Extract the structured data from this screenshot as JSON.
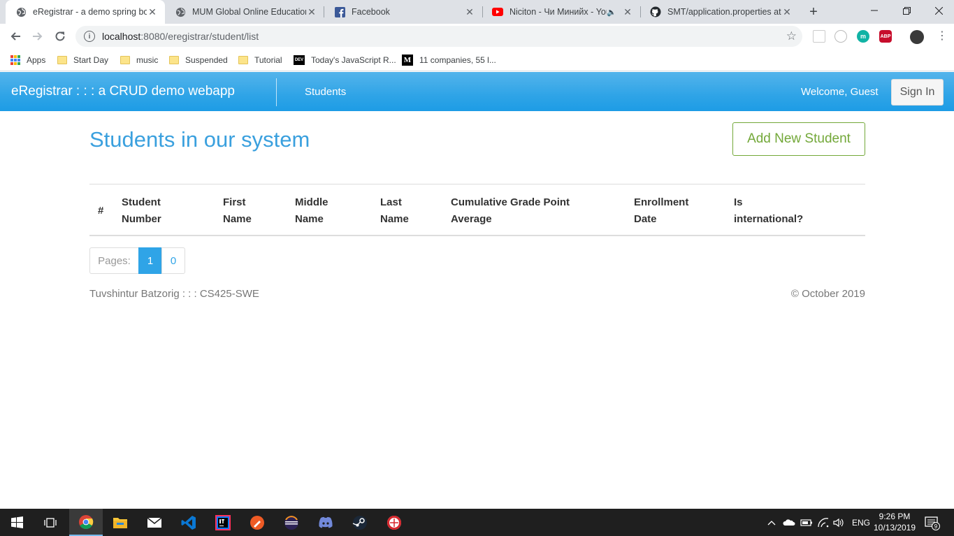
{
  "browser": {
    "tabs": [
      {
        "title": "eRegistrar - a demo spring boo",
        "favicon": "globe-icon",
        "active": true
      },
      {
        "title": "MUM Global Online Education",
        "favicon": "globe-icon",
        "active": false
      },
      {
        "title": "Facebook",
        "favicon": "facebook-icon",
        "active": false
      },
      {
        "title": "Niciton - Чи Минийх - You",
        "favicon": "youtube-icon",
        "active": false,
        "audio": true
      },
      {
        "title": "SMT/application.properties at",
        "favicon": "github-icon",
        "active": false
      }
    ],
    "url_host": "localhost",
    "url_rest": ":8080/eregistrar/student/list",
    "bookmarks": [
      {
        "label": "Apps",
        "icon": "apps-grid-icon"
      },
      {
        "label": "Start Day",
        "icon": "folder-icon"
      },
      {
        "label": "music",
        "icon": "folder-icon"
      },
      {
        "label": "Suspended",
        "icon": "folder-icon"
      },
      {
        "label": "Tutorial",
        "icon": "folder-icon"
      },
      {
        "label": "Today's JavaScript R...",
        "icon": "dev-icon"
      },
      {
        "label": "11 companies, 55 l...",
        "icon": "medium-icon"
      }
    ],
    "dev_icon_text": "DEV",
    "medium_icon_text": "M",
    "abp_text": "ABP"
  },
  "navbar": {
    "brand": "eRegistrar : : : a CRUD demo webapp",
    "link_students": "Students",
    "welcome": "Welcome, Guest",
    "sign_in": "Sign In",
    "color": "#2fa4e7"
  },
  "main": {
    "title": "Students in our system",
    "add_button": "Add New Student",
    "table": {
      "headers": [
        [
          "#"
        ],
        [
          "Student",
          "Number"
        ],
        [
          "First",
          "Name"
        ],
        [
          "Middle",
          "Name"
        ],
        [
          "Last",
          "Name"
        ],
        [
          "Cumulative Grade Point",
          "Average"
        ],
        [
          "Enrollment",
          "Date"
        ],
        [
          "Is",
          "international?"
        ]
      ],
      "rows": []
    },
    "pagination": {
      "label": "Pages:",
      "active_page": "1",
      "other_page": "0"
    }
  },
  "footer": {
    "left": "Tuvshintur Batzorig : : : CS425-SWE",
    "right": "© October 2019"
  },
  "taskbar": {
    "language": "ENG",
    "time": "9:26 PM",
    "date": "10/13/2019",
    "notifications": "9",
    "apps": [
      "windows-start-icon",
      "task-view-icon",
      "chrome-icon",
      "file-explorer-icon",
      "mail-icon",
      "vscode-icon",
      "intellij-icon",
      "postman-icon",
      "eclipse-icon",
      "discord-icon",
      "steam-icon",
      "opera-icon"
    ]
  }
}
